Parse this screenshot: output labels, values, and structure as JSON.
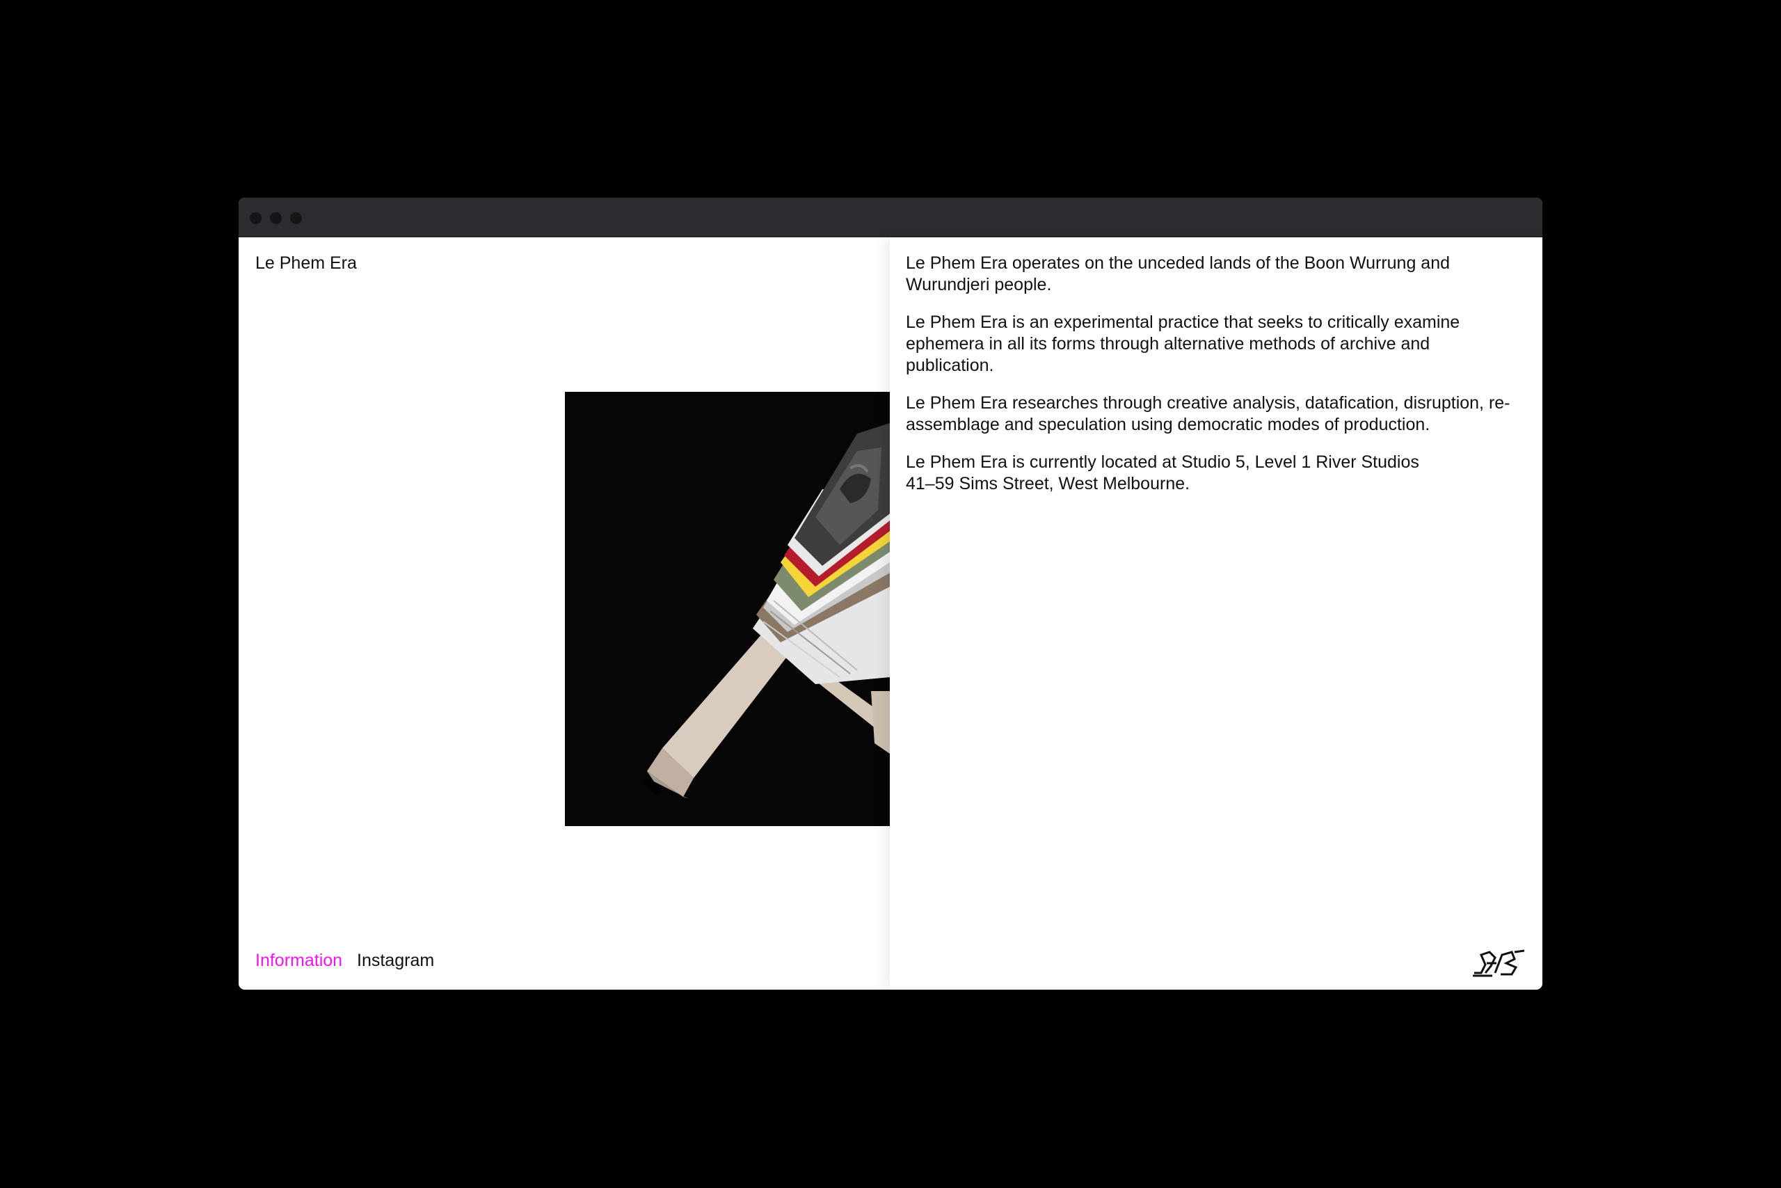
{
  "window": {
    "controls": [
      "close",
      "minimize",
      "zoom"
    ]
  },
  "site": {
    "title": "Le Phem Era"
  },
  "nav": {
    "items": [
      {
        "label": "Information",
        "active": true
      },
      {
        "label": "Instagram",
        "active": false
      }
    ],
    "active_color": "#f015f0"
  },
  "info": {
    "paragraphs": [
      "Le Phem Era operates on the unceded lands of the Boon Wurrung and Wurundjeri people.",
      "Le Phem Era is an experimental practice that seeks to critically examine ephemera in all its forms through alternative methods of archive and publication.",
      "Le Phem Era researches through creative analysis, datafication, disruption, re-assemblage and speculation using democratic modes of production.",
      "Le Phem Era is currently located at Studio 5, Level 1 River Studios\n41–59 Sims Street, West Melbourne."
    ]
  },
  "image": {
    "subject": "stack of printed ephemera on a light wooden stand against black background"
  },
  "logo": {
    "icon": "monogram-logo-icon"
  }
}
